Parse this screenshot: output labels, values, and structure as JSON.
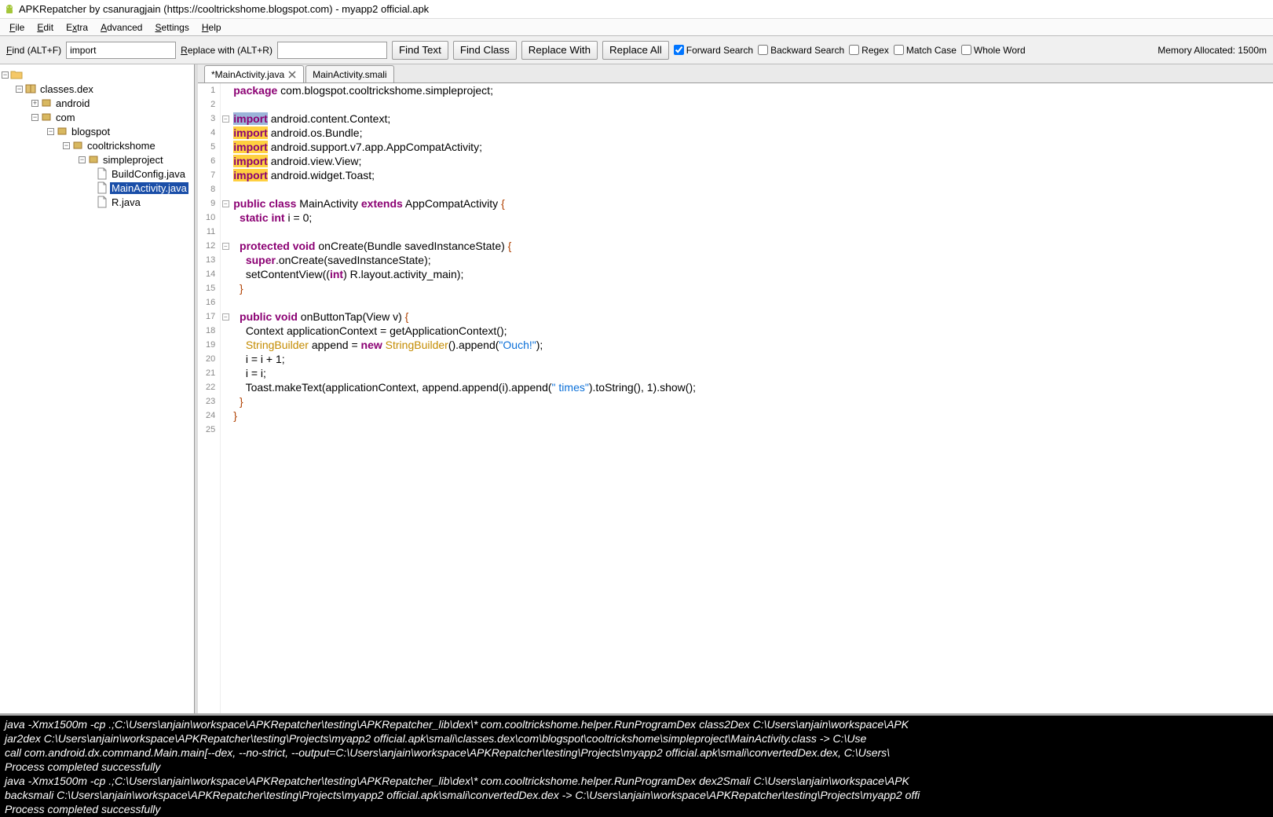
{
  "window": {
    "title": "APKRepatcher by csanuragjain (https://cooltrickshome.blogspot.com) - myapp2 official.apk"
  },
  "menu": {
    "file": "File",
    "edit": "Edit",
    "extra": "Extra",
    "advanced": "Advanced",
    "settings": "Settings",
    "help": "Help"
  },
  "toolbar": {
    "find_label": "Find (ALT+F)",
    "find_value": "import",
    "replace_label": "Replace with (ALT+R)",
    "replace_value": "",
    "find_text_btn": "Find Text",
    "find_class_btn": "Find Class",
    "replace_with_btn": "Replace With",
    "replace_all_btn": "Replace All",
    "forward_search": "Forward Search",
    "backward_search": "Backward Search",
    "regex": "Regex",
    "match_case": "Match Case",
    "whole_word": "Whole Word",
    "mem_label": "Memory Allocated: 1500m"
  },
  "tree": {
    "root": "",
    "classes_dex": "classes.dex",
    "android": "android",
    "com": "com",
    "blogspot": "blogspot",
    "cooltrickshome": "cooltrickshome",
    "simpleproject": "simpleproject",
    "buildconfig": "BuildConfig.java",
    "mainactivity": "MainActivity.java",
    "r_java": "R.java"
  },
  "tabs": {
    "tab1": "*MainActivity.java",
    "tab2": "MainActivity.smali"
  },
  "code": {
    "l1": {
      "kw": "package",
      "rest": " com.blogspot.cooltrickshome.simpleproject;"
    },
    "l3": {
      "kw": "import",
      "rest": " android.content.Context;"
    },
    "l4": {
      "kw": "import",
      "rest": " android.os.Bundle;"
    },
    "l5": {
      "kw": "import",
      "rest": " android.support.v7.app.AppCompatActivity;"
    },
    "l6": {
      "kw": "import",
      "rest": " android.view.View;"
    },
    "l7": {
      "kw": "import",
      "rest": " android.widget.Toast;"
    },
    "l9_a": "public class",
    "l9_b": " MainActivity ",
    "l9_c": "extends",
    "l9_d": " AppCompatActivity ",
    "l9_e": "{",
    "l10_a": "static int",
    "l10_b": " i = ",
    "l10_c": "0",
    "l10_d": ";",
    "l12_a": "protected void",
    "l12_b": " onCreate",
    "l12_c": "(",
    "l12_d": "Bundle savedInstanceState",
    "l12_e": ")",
    "l12_f": " {",
    "l13_a": "super",
    "l13_b": ".onCreate",
    "l13_c": "(",
    "l13_d": "savedInstanceState",
    "l13_e": ");",
    "l14_a": "setContentView",
    "l14_b": "((",
    "l14_c": "int",
    "l14_d": ")",
    "l14_e": " R.layout.activity_main",
    "l14_f": ");",
    "l15": "}",
    "l17_a": "public void",
    "l17_b": " onButtonTap",
    "l17_c": "(",
    "l17_d": "View v",
    "l17_e": ")",
    "l17_f": " {",
    "l18_a": "Context applicationContext = getApplicationContext",
    "l18_b": "();",
    "l19_a": "StringBuilder",
    "l19_b": " append = ",
    "l19_c": "new",
    "l19_d": " ",
    "l19_e": "StringBuilder",
    "l19_f": "()",
    "l19_g": ".append",
    "l19_h": "(",
    "l19_i": "\"Ouch!\"",
    "l19_j": ");",
    "l20": "i = i + 1;",
    "l21": "i = i;",
    "l22_a": "Toast.makeText",
    "l22_b": "(",
    "l22_c": "applicationContext, append.append",
    "l22_d": "(",
    "l22_e": "i",
    "l22_f": ")",
    "l22_g": ".append",
    "l22_h": "(",
    "l22_i": "\" times\"",
    "l22_j": ")",
    "l22_k": ".toString",
    "l22_l": "(), ",
    "l22_m": "1",
    "l22_n": ")",
    "l22_o": ".show",
    "l22_p": "();",
    "l23": "}",
    "l24": "}"
  },
  "console": {
    "l1": "java -Xmx1500m -cp .;C:\\Users\\anjain\\workspace\\APKRepatcher\\testing\\APKRepatcher_lib\\dex\\* com.cooltrickshome.helper.RunProgramDex class2Dex C:\\Users\\anjain\\workspace\\APK",
    "l2": "jar2dex C:\\Users\\anjain\\workspace\\APKRepatcher\\testing\\Projects\\myapp2 official.apk\\smali\\classes.dex\\com\\blogspot\\cooltrickshome\\simpleproject\\MainActivity.class -> C:\\Use",
    "l3": "call com.android.dx.command.Main.main[--dex, --no-strict, --output=C:\\Users\\anjain\\workspace\\APKRepatcher\\testing\\Projects\\myapp2 official.apk\\smali\\convertedDex.dex, C:\\Users\\",
    "l4": "Process completed successfully",
    "l5": "java -Xmx1500m -cp .;C:\\Users\\anjain\\workspace\\APKRepatcher\\testing\\APKRepatcher_lib\\dex\\* com.cooltrickshome.helper.RunProgramDex dex2Smali C:\\Users\\anjain\\workspace\\APK",
    "l6": "backsmali C:\\Users\\anjain\\workspace\\APKRepatcher\\testing\\Projects\\myapp2 official.apk\\smali\\convertedDex.dex -> C:\\Users\\anjain\\workspace\\APKRepatcher\\testing\\Projects\\myapp2 offi",
    "l7": "Process completed successfully"
  }
}
